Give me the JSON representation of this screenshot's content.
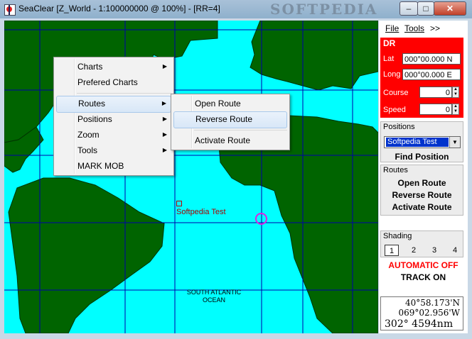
{
  "window": {
    "title": "SeaClear [Z_World - 1:100000000 @ 100%] - [RR=4]",
    "watermark": "SOFTPEDIA",
    "min_label": "–",
    "max_label": "□",
    "close_label": "✕"
  },
  "menubar": {
    "file": "File",
    "tools": "Tools",
    "more": ">>"
  },
  "context_menu": {
    "items": [
      {
        "label": "Charts",
        "submenu": true
      },
      {
        "label": "Prefered Charts",
        "submenu": false
      },
      {
        "label": "Routes",
        "submenu": true
      },
      {
        "label": "Positions",
        "submenu": true
      },
      {
        "label": "Zoom",
        "submenu": true
      },
      {
        "label": "Tools",
        "submenu": true
      },
      {
        "label": "MARK MOB",
        "submenu": false
      }
    ],
    "selected": "Routes"
  },
  "routes_submenu": {
    "items": [
      "Open Route",
      "Reverse Route",
      "Activate Route"
    ],
    "selected": "Reverse Route"
  },
  "map": {
    "waypoint_label": "Softpedia Test",
    "ocean_label_1": "SOUTH ATLANTIC",
    "ocean_label_2": "OCEAN",
    "colors": {
      "water": "#00ffff",
      "land": "#006400",
      "grid": "#0000aa",
      "waypoint": "#b00000",
      "mob_ring": "#e020e0"
    }
  },
  "dr": {
    "title": "DR",
    "lat_label": "Lat",
    "lat_value": "000°00.000 N",
    "long_label": "Long",
    "long_value": "000°00.000 E",
    "course_label": "Course",
    "course_value": "0",
    "speed_label": "Speed",
    "speed_value": "0"
  },
  "positions": {
    "label": "Positions",
    "selected": "Softpedia Test",
    "find_button": "Find Position"
  },
  "routes_panel": {
    "label": "Routes",
    "open": "Open Route",
    "reverse": "Reverse Route",
    "activate": "Activate Route"
  },
  "shading": {
    "label": "Shading",
    "options": [
      "1",
      "2",
      "3",
      "4"
    ],
    "selected": "1"
  },
  "automatic": {
    "label": "AUTOMATIC OFF",
    "color": "#ff0000"
  },
  "track": {
    "label": "TRACK ON"
  },
  "readout": {
    "lat": "40°58.173'N",
    "lon": "069°02.956'W",
    "bearing_range": "302°  4594nm"
  }
}
